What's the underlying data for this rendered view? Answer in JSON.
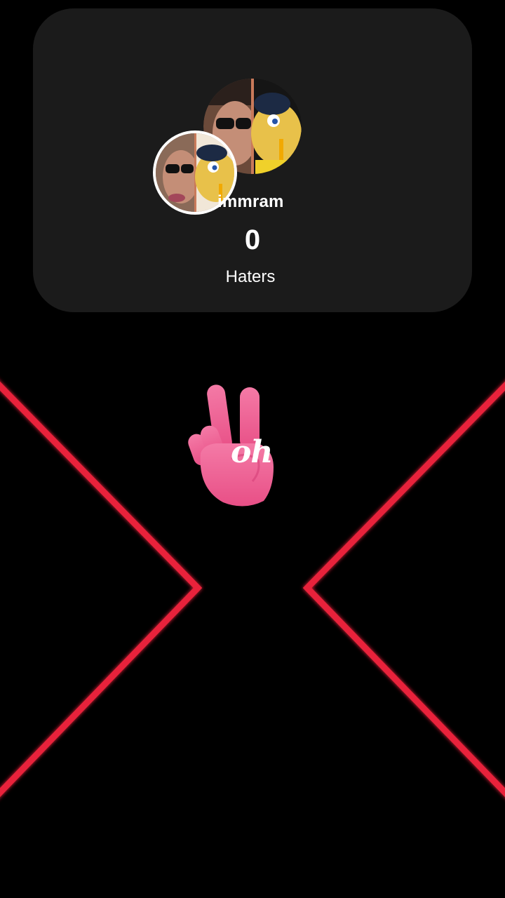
{
  "profile": {
    "username": "immram",
    "count": "0",
    "count_label": "Haters",
    "avatar_large_icon": "profile-avatar-large",
    "avatar_small_icon": "profile-avatar-small"
  },
  "sticker": {
    "icon": "peace-hand-icon",
    "text": "oh",
    "color": "#f2679a"
  },
  "frame": {
    "color": "#e8203a"
  }
}
